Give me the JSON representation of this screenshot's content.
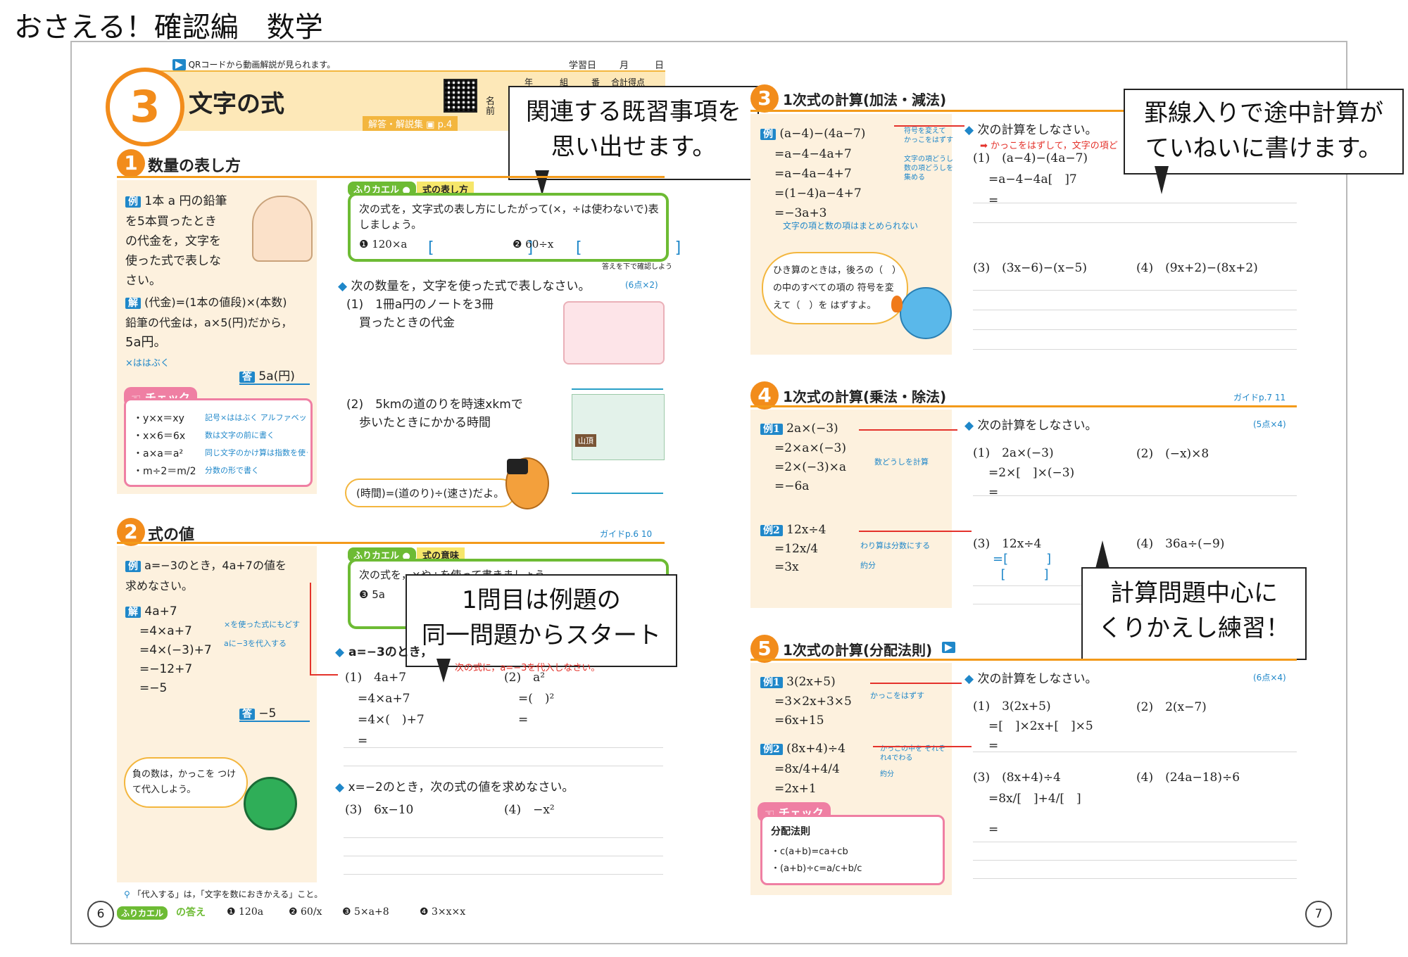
{
  "page_title": "おさえる！確認編　数学",
  "header": {
    "qr_note": "QRコードから動画解説が見られます。",
    "study_date_label": "学習日",
    "month_label": "月",
    "day_label": "日",
    "year_label": "年",
    "class_label": "組",
    "number_label": "番",
    "total_score_label": "合計得点",
    "name_label": "名前",
    "chapter_number": "3",
    "chapter_title": "文字の式",
    "answer_book_label": "解答・解説集",
    "answer_book_page": "p.4"
  },
  "callouts": {
    "c1_line1": "関連する既習事項を",
    "c1_line2": "思い出せます。",
    "c2_line1": "罫線入りで途中計算が",
    "c2_line2": "ていねいに書けます。",
    "c3_line1": "1問目は例題の",
    "c3_line2": "同一問題からスタート",
    "c4_line1": "計算問題中心に",
    "c4_line2": "くりかえし練習！"
  },
  "left_page": {
    "page_number": "6",
    "sec1": {
      "num": "1",
      "title": "数量の表し方",
      "ex_label": "例",
      "ex_text_1": "1本 a 円の鉛筆",
      "ex_text_2": "を5本買ったとき",
      "ex_text_3": "の代金を，文字を",
      "ex_text_4": "使った式で表しな",
      "ex_text_5": "さい。",
      "sol_label": "解",
      "sol_1": "(代金)=(1本の値段)×(本数)",
      "sol_2": "鉛筆の代金は，a×5(円)だから，",
      "sol_3": "5a円。",
      "sol_4": "×ははぶく",
      "ans_label": "答",
      "ans_text": "5a(円)",
      "check_label": "チェック",
      "check_1": "・y×x＝xy",
      "check_1n": "記号×ははぶく アルファベットの順に書く",
      "check_2": "・x×6＝6x",
      "check_2n": "数は文字の前に書く",
      "check_3": "・a×a＝a²",
      "check_3n": "同じ文字のかけ算は指数を使って書く",
      "check_4": "・m÷2＝m/2",
      "check_4n": "分数の形で書く",
      "furikaeru_label": "ふりカエル",
      "furikaeru_title": "式の表し方",
      "furi_q": "次の式を，文字式の表し方にしたがって(×，÷は使わないで)表しましょう。",
      "furi_1": "❶ 120×a",
      "furi_2": "❷ 60÷x",
      "furi_note": "答えを下で確認しよう",
      "task": "次の数量を，文字を使った式で表しなさい。",
      "points": "(6点×2)",
      "q1": "(1)　1冊a円のノートを3冊",
      "q1b": "買ったときの代金",
      "q2": "(2)　5kmの道のりを時速xkmで",
      "q2b": "歩いたときにかかる時間",
      "hint": "(時間)=(道のり)÷(速さ)だよ。",
      "sign_text": "山頂"
    },
    "sec2": {
      "num": "2",
      "title": "式の値",
      "guide": "ガイドp.6 10",
      "ex_label": "例",
      "ex_text_1": "a=−3のとき，4a+7の値を",
      "ex_text_2": "求めなさい。",
      "sol_label": "解",
      "sol_1": "4a+7",
      "sol_2": "=4×a+7",
      "sol_3": "=4×(−3)+7",
      "sol_4": "=−12+7",
      "sol_5": "=−5",
      "note_1": "×を使った式にもどす",
      "note_2": "aに−3を代入する",
      "ans_label": "答",
      "ans_text": "−5",
      "bubble": "負の数は，かっこを つけて代入しよう。",
      "furikaeru_label": "ふりカエル",
      "furikaeru_title": "式の意味",
      "furi_q": "次の式を，×や÷を使って書きましょう。",
      "furi_3": "❸ 5a",
      "task1": "a=−3のとき，",
      "task1_note": "次の式に，a=−3を代入しなさい。",
      "q1": "(1)　4a+7",
      "q1_2": "=4×a+7",
      "q1_3": "=4×(　)+7",
      "q1_4": "=",
      "q2": "(2)　a²",
      "q2_2": "=(　)²",
      "q2_3": "=",
      "task2": "x=−2のとき，次の式の値を求めなさい。",
      "q3": "(3)　6x−10",
      "q4": "(4)　−x²",
      "footnote": "「代入する」は，「文字を数におきかえる」こと。"
    },
    "footer": {
      "label": "ふりカエル",
      "answers_label": "の答え",
      "a1": "❶ 120a",
      "a2": "❷ 60/x",
      "a3": "❸ 5×a+8",
      "a4": "❹ 3×x×x"
    }
  },
  "right_page": {
    "page_number": "7",
    "sec3": {
      "num": "3",
      "title": "1次式の計算(加法・減法)",
      "ex_label": "例",
      "ex_1": "(a−4)−(4a−7)",
      "ex_2": "=a−4−4a+7",
      "ex_3": "=a−4a−4+7",
      "ex_4": "=(1−4)a−4+7",
      "ex_5": "=−3a+3",
      "ex_note": "文字の項と数の項はまとめられない",
      "note_a": "符号を変えて かっこをはずす",
      "note_b": "文字の項どうし 数の項どうしを 集める",
      "bubble": "ひき算のときは，後ろの（　）の中のすべての項の 符号を変えて（　）を はずすよ。",
      "task": "次の計算をしなさい。",
      "task_note": "かっこをはずして，文字の項ど",
      "q1": "(1)　(a−4)−(4a−7)",
      "q1_2": "=a−4−4a[　]7",
      "q1_3": "=",
      "q3": "(3)　(3x−6)−(x−5)",
      "q4": "(4)　(9x+2)−(8x+2)"
    },
    "sec4": {
      "num": "4",
      "title": "1次式の計算(乗法・除法)",
      "guide": "ガイドp.7 11",
      "ex1_label": "例1",
      "ex1_1": "2a×(−3)",
      "ex1_2": "=2×a×(−3)",
      "ex1_3": "=2×(−3)×a",
      "ex1_4": "=−6a",
      "ex1_note": "数どうしを計算",
      "ex2_label": "例2",
      "ex2_1": "12x÷4",
      "ex2_2": "=12x/4",
      "ex2_3": "=3x",
      "ex2_note_1": "わり算は分数にする",
      "ex2_note_2": "約分",
      "task": "次の計算をしなさい。",
      "points": "(5点×4)",
      "q1": "(1)　2a×(−3)",
      "q1_2": "=2×[　]×(−3)",
      "q1_3": "=",
      "q2": "(2)　(−x)×8",
      "q3": "(3)　12x÷4",
      "q4": "(4)　36a÷(−9)"
    },
    "sec5": {
      "num": "5",
      "title": "1次式の計算(分配法則)",
      "ex1_label": "例1",
      "ex1_1": "3(2x+5)",
      "ex1_2": "=3×2x+3×5",
      "ex1_3": "=6x+15",
      "ex1_note": "かっこをはずす",
      "ex2_label": "例2",
      "ex2_1": "(8x+4)÷4",
      "ex2_2": "=8x/4+4/4",
      "ex2_3": "=2x+1",
      "ex2_note_1": "かっこの中を それぞれ4でわる",
      "ex2_note_2": "約分",
      "check_label": "チェック",
      "check_title": "分配法則",
      "check_1": "・c(a+b)=ca+cb",
      "check_2": "・(a+b)÷c=a/c+b/c",
      "task": "次の計算をしなさい。",
      "points": "(6点×4)",
      "q1": "(1)　3(2x+5)",
      "q1_2": "=[　]×2x+[　]×5",
      "q1_3": "=",
      "q2": "(2)　2(x−7)",
      "q3": "(3)　(8x+4)÷4",
      "q3_2": "=8x/[　]+4/[　]",
      "q3_3": "=",
      "q4": "(4)　(24a−18)÷6"
    }
  },
  "colors": {
    "accent_orange": "#f28c1b",
    "accent_blue": "#1f87c9",
    "accent_red": "#e4322b",
    "accent_pink": "#ef7fa3",
    "accent_green": "#6dbb34",
    "cream": "#fdf1de"
  }
}
